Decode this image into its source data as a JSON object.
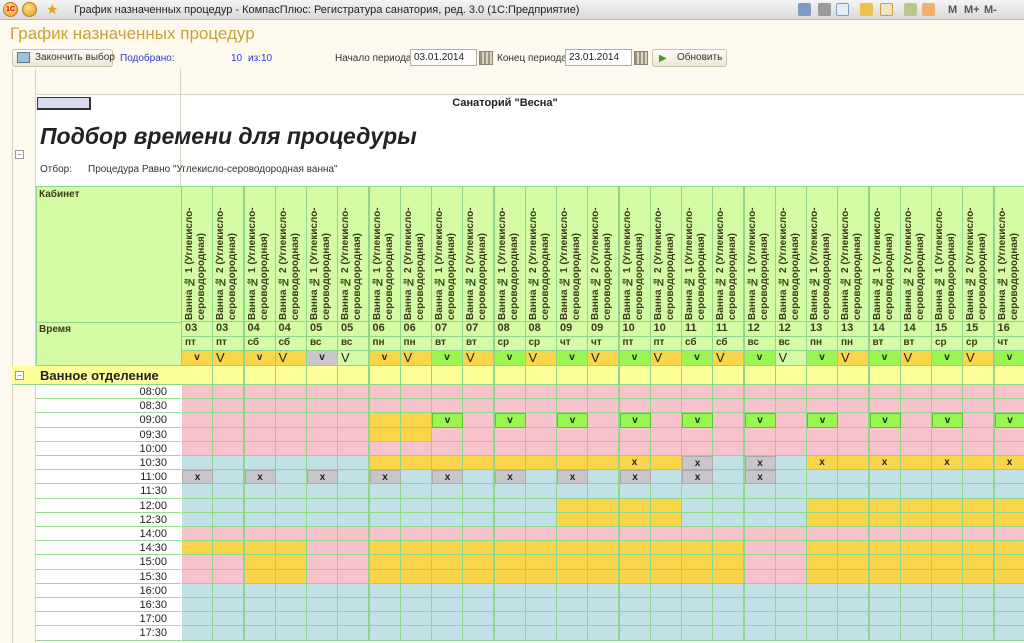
{
  "window": {
    "title": "График назначенных процедур - КомпасПлюс: Регистратура санатория, ред. 3.0  (1С:Предприятие)",
    "logo": "1С",
    "icons": [
      "save-icon",
      "print-icon",
      "preview-icon",
      "home-icon",
      "favorites-icon",
      "calculator-icon",
      "calendar-icon"
    ],
    "memory": [
      "M",
      "M+",
      "M-"
    ]
  },
  "form": {
    "title": "График назначенных процедур",
    "finish_button": "Закончить выбор",
    "selected_label": "Подобрано:",
    "selected_count": "10",
    "of_label": "из:10",
    "start_label": "Начало периода:",
    "start_value": "03.01.2014",
    "end_label": "Конец периода:",
    "end_value": "23.01.2014",
    "refresh_button": "Обновить"
  },
  "report": {
    "organization": "Санаторий \"Весна\"",
    "heading": "Подбор времени для процедуры",
    "filter_label": "Отбор:",
    "filter_value": "Процедура Равно \"Углекисло-сероводородная ванна\"",
    "cabinet_label": "Кабинет",
    "time_label": "Время",
    "section": "Ванное отделение",
    "cabinets": [
      "Ванна № 1 (Углекисло-сероводородная)",
      "Ванна № 2 (Углекисло-сероводородная)"
    ],
    "times": [
      "08:00",
      "08:30",
      "09:00",
      "09:30",
      "10:00",
      "10:30",
      "11:00",
      "11:30",
      "12:00",
      "12:30",
      "14:00",
      "14:30",
      "15:00",
      "15:30",
      "16:00",
      "16:30",
      "17:00",
      "17:30"
    ],
    "head_marks": [
      "v",
      "V"
    ],
    "marks": {
      "G": "v",
      "X": "x",
      "Z": "x"
    },
    "colors": {
      "P": "#f7c4cd",
      "Y": "#f9d54a",
      "B": "#c2e1e6",
      "G": "#9af551",
      "X": "#c8c6cb",
      "Z": "#f9d54a",
      "O": "#f9d54a",
      "L": "#d4fca4",
      "header": "#d4fca4",
      "section": "#ffff99"
    },
    "days": [
      {
        "date": "03",
        "weekday": "пт",
        "head": [
          "O",
          "O"
        ],
        "cols": [
          "PPPPPBXBBBPYPPBBBB",
          "PPPPPBBBBBPYPPBBBB"
        ]
      },
      {
        "date": "04",
        "weekday": "сб",
        "head": [
          "O",
          "O"
        ],
        "cols": [
          "PPPPPBXBBBPYYYBBBB",
          "PPPPPBBBBBPYYYBBBB"
        ]
      },
      {
        "date": "05",
        "weekday": "вс",
        "head": [
          "X",
          "L"
        ],
        "cols": [
          "PPPPPBXBBBPPPPBBBB",
          "PPPPPBBBBBPPPPBBBB"
        ]
      },
      {
        "date": "06",
        "weekday": "пн",
        "head": [
          "O",
          "O"
        ],
        "cols": [
          "PPYYPYXBBBPYYYBBBB",
          "PPYYPYBBBBPYYYBBBB"
        ]
      },
      {
        "date": "07",
        "weekday": "вт",
        "head": [
          "G",
          "O"
        ],
        "cols": [
          "PPGPPYXBBBPYYYBBBB",
          "PPPPPYBBBBPYYYBBBB"
        ]
      },
      {
        "date": "08",
        "weekday": "ср",
        "head": [
          "G",
          "O"
        ],
        "cols": [
          "PPGPPYXBBBPYYYBBBB",
          "PPPPPYBBBBPYYYBBBB"
        ]
      },
      {
        "date": "09",
        "weekday": "чт",
        "head": [
          "G",
          "O"
        ],
        "cols": [
          "PPGPPYXBYYPYYYBBBB",
          "PPPPPYBBYYPYYYBBBB"
        ]
      },
      {
        "date": "10",
        "weekday": "пт",
        "head": [
          "G",
          "O"
        ],
        "cols": [
          "PPGPPZXBYYPYYYBBBB",
          "PPPPPYBBYYPYYYBBBB"
        ]
      },
      {
        "date": "11",
        "weekday": "сб",
        "head": [
          "G",
          "O"
        ],
        "cols": [
          "PPGPPXXBBBPYYYBBBB",
          "PPPPPBBBBBPYYYBBBB"
        ]
      },
      {
        "date": "12",
        "weekday": "вс",
        "head": [
          "G",
          "L"
        ],
        "cols": [
          "PPGPPXXBBBPPPPBBBB",
          "PPPPPBBBBBPPPPBBBB"
        ]
      },
      {
        "date": "13",
        "weekday": "пн",
        "head": [
          "G",
          "O"
        ],
        "cols": [
          "PPGPPZBBYYPYYYBBBB",
          "PPPPPYBBYYPYYYBBBB"
        ]
      },
      {
        "date": "14",
        "weekday": "вт",
        "head": [
          "G",
          "O"
        ],
        "cols": [
          "PPGPPZBBYYPYYYBBBB",
          "PPPPPYBBYYPYYYBBBB"
        ]
      },
      {
        "date": "15",
        "weekday": "ср",
        "head": [
          "G",
          "O"
        ],
        "cols": [
          "PPGPPZBBYYPYYYBBBB",
          "PPPPPYBBYYPYYYBBBB"
        ]
      },
      {
        "date": "16",
        "weekday": "чт",
        "head": [
          "G"
        ],
        "cols": [
          "PPGPPZBBYYPYYYBBBB"
        ]
      }
    ]
  }
}
